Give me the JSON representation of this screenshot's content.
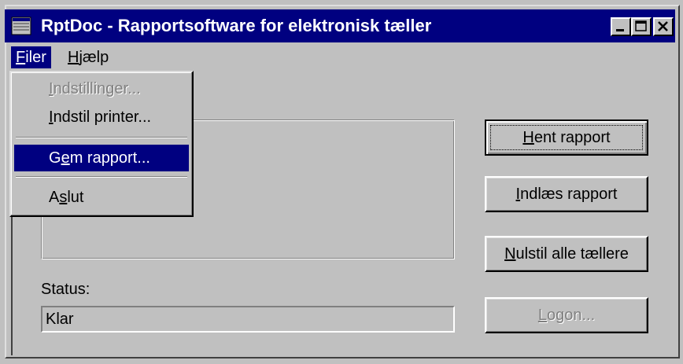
{
  "window": {
    "title": "RptDoc - Rapportsoftware for elektronisk tæller",
    "icon": "app-window-icon",
    "controls": [
      "minimize-icon",
      "maximize-icon",
      "close-icon"
    ]
  },
  "menubar": {
    "items": [
      {
        "label": "Filer",
        "accel": "F",
        "rest": "iler",
        "active": true
      },
      {
        "label": "Hjælp",
        "accel": "H",
        "rest": "jælp",
        "active": false
      }
    ]
  },
  "file_menu": {
    "items": [
      {
        "pre": "",
        "accel": "I",
        "post": "ndstillinger...",
        "disabled": true,
        "selected": false
      },
      {
        "pre": "",
        "accel": "I",
        "post": "ndstil printer...",
        "disabled": false,
        "selected": false
      },
      {
        "pre": "G",
        "accel": "e",
        "post": "m rapport...",
        "disabled": false,
        "selected": true
      },
      {
        "pre": "A",
        "accel": "s",
        "post": "lut",
        "disabled": false,
        "selected": false
      }
    ]
  },
  "status": {
    "label": "Status:",
    "value": "Klar"
  },
  "buttons": {
    "hent": {
      "accel": "H",
      "rest": "ent rapport"
    },
    "indlaes": {
      "accel": "I",
      "rest": "ndlæs rapport"
    },
    "nulstil": {
      "accel": "N",
      "rest": "ulstil alle tællere"
    },
    "logon": {
      "accel": "L",
      "rest": "ogon...",
      "disabled": true
    }
  },
  "colors": {
    "titlebar": "#000080",
    "face": "#c0c0c0",
    "highlight": "#000080"
  }
}
